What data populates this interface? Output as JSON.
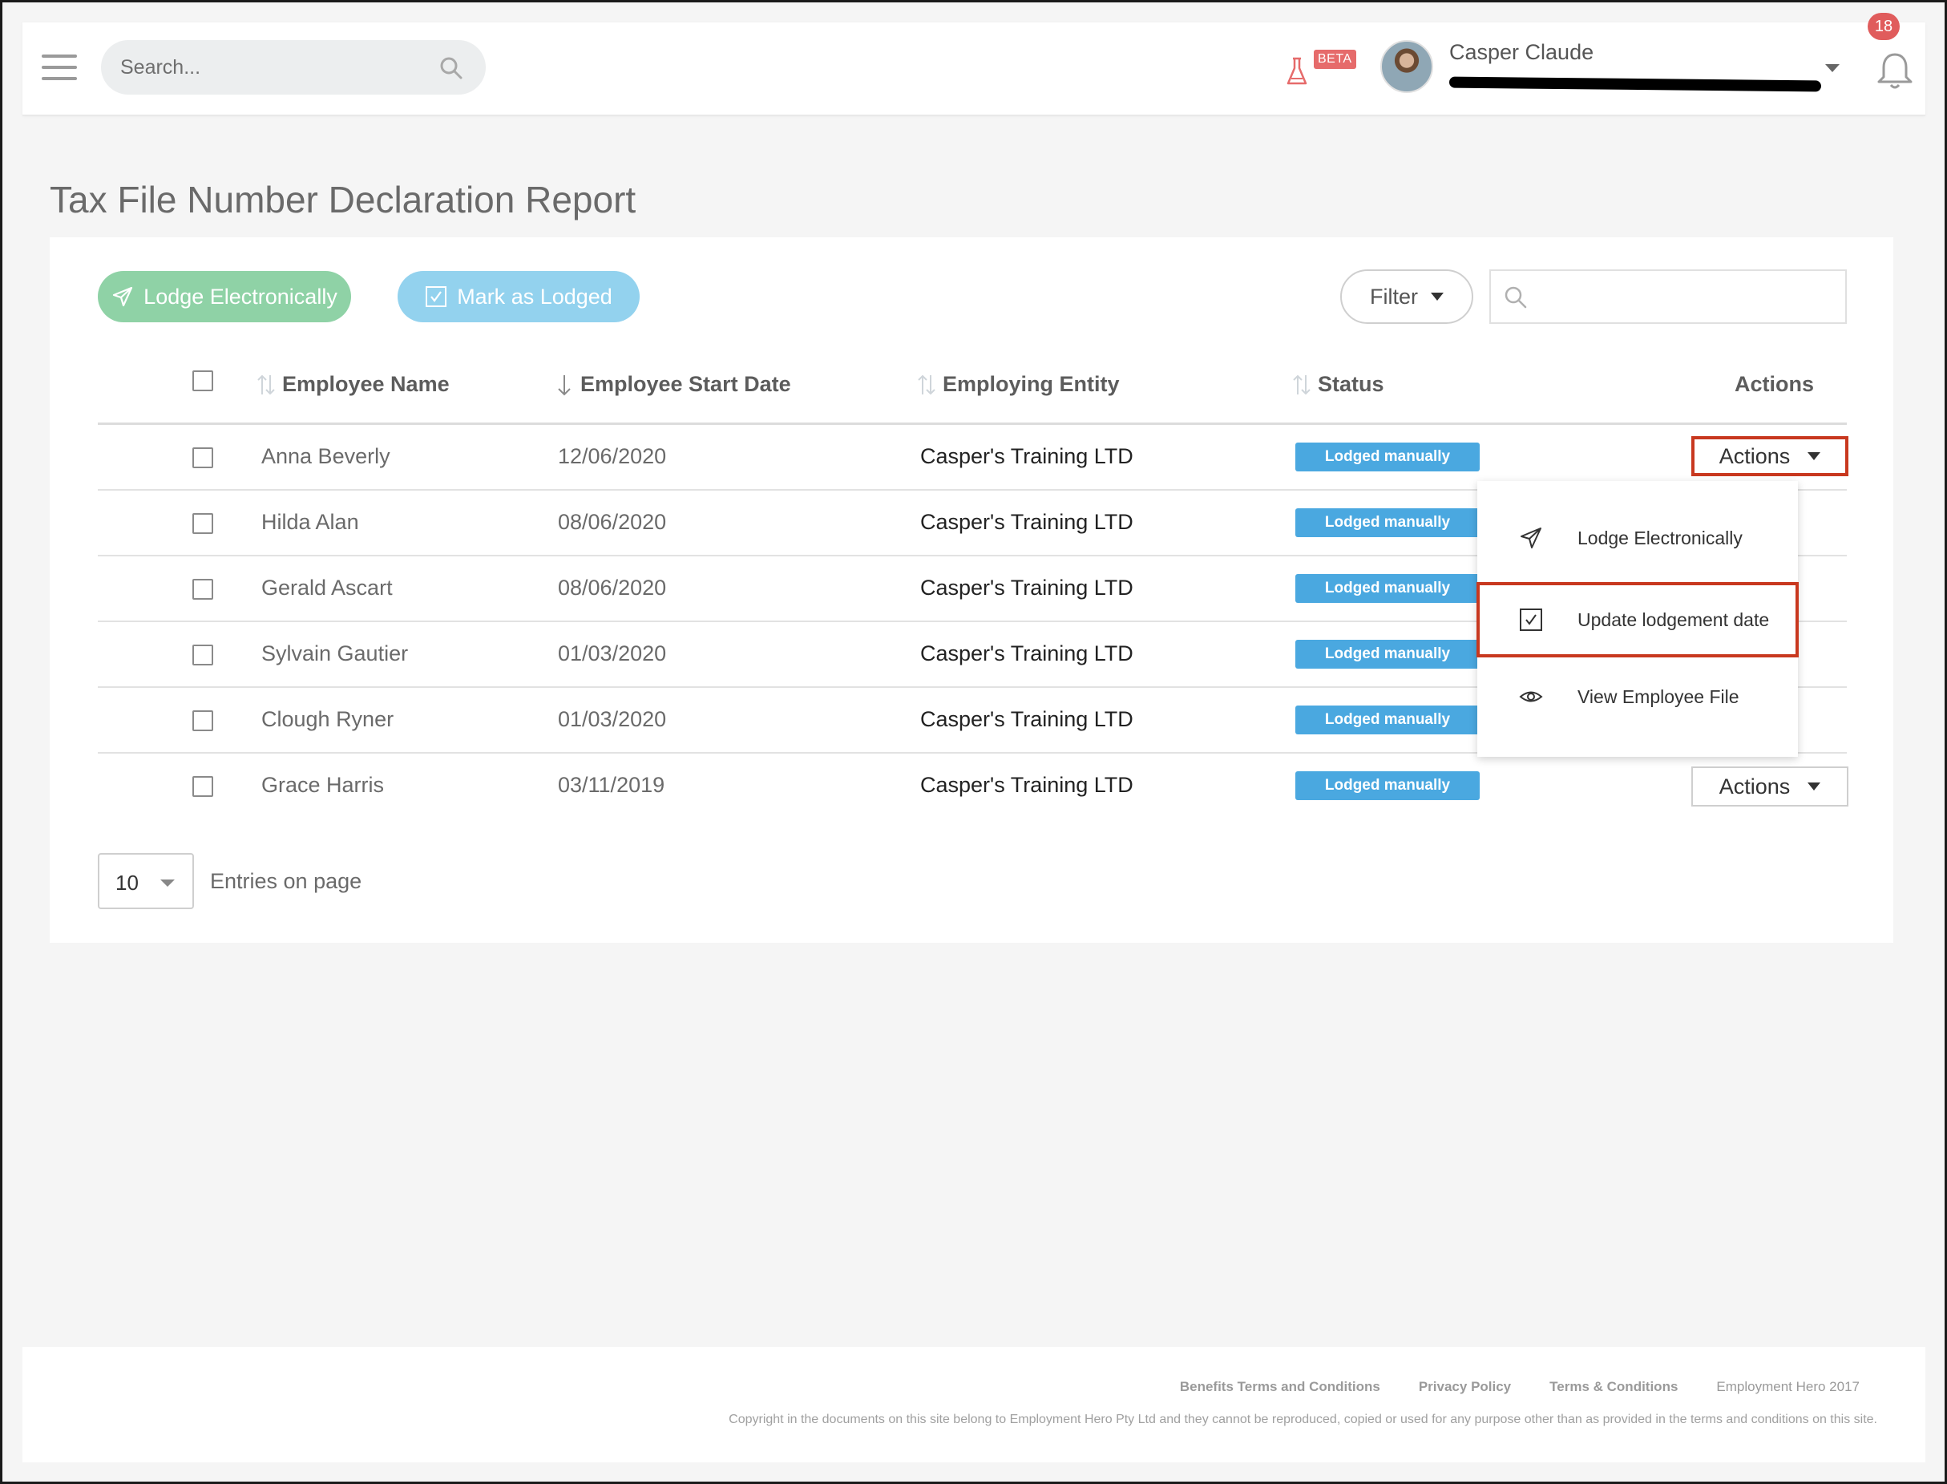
{
  "header": {
    "search_placeholder": "Search...",
    "beta_label": "BETA",
    "user_name": "Casper Claude",
    "notification_count": "18"
  },
  "page": {
    "title": "Tax File Number Declaration Report"
  },
  "toolbar": {
    "lodge_label": "Lodge Electronically",
    "mark_label": "Mark as Lodged",
    "filter_label": "Filter"
  },
  "table": {
    "columns": {
      "name": "Employee Name",
      "date": "Employee Start Date",
      "entity": "Employing Entity",
      "status": "Status",
      "actions": "Actions"
    },
    "rows": [
      {
        "name": "Anna Beverly",
        "date": "12/06/2020",
        "entity": "Casper's Training LTD",
        "status": "Lodged manually",
        "actions": "Actions"
      },
      {
        "name": "Hilda Alan",
        "date": "08/06/2020",
        "entity": "Casper's Training LTD",
        "status": "Lodged manually",
        "actions": "Actions"
      },
      {
        "name": "Gerald Ascart",
        "date": "08/06/2020",
        "entity": "Casper's Training LTD",
        "status": "Lodged manually",
        "actions": "Actions"
      },
      {
        "name": "Sylvain Gautier",
        "date": "01/03/2020",
        "entity": "Casper's Training LTD",
        "status": "Lodged manually",
        "actions": "Actions"
      },
      {
        "name": "Clough Ryner",
        "date": "01/03/2020",
        "entity": "Casper's Training LTD",
        "status": "Lodged manually",
        "actions": "Actions"
      },
      {
        "name": "Grace Harris",
        "date": "03/11/2019",
        "entity": "Casper's Training LTD",
        "status": "Lodged manually",
        "actions": "Actions"
      }
    ]
  },
  "dropdown": {
    "items": [
      {
        "label": "Lodge Electronically",
        "icon": "paper-plane-icon"
      },
      {
        "label": "Update lodgement date",
        "icon": "checkbox-checked-icon"
      },
      {
        "label": "View Employee File",
        "icon": "eye-icon"
      }
    ]
  },
  "pagination": {
    "page_size": "10",
    "entries_label": "Entries on page"
  },
  "footer": {
    "links": [
      "Benefits Terms and Conditions",
      "Privacy Policy",
      "Terms & Conditions"
    ],
    "brand": "Employment Hero 2017",
    "copyright": "Copyright in the documents on this site belong to Employment Hero Pty Ltd and they cannot be reproduced, copied or used for any purpose other than as provided in the terms and conditions on this site."
  },
  "colors": {
    "lodge_button": "#8fd2a6",
    "mark_button": "#93d2ee",
    "status_badge": "#4aa8e0",
    "highlight_border": "#c8381f",
    "notification_badge": "#e05c5c"
  }
}
